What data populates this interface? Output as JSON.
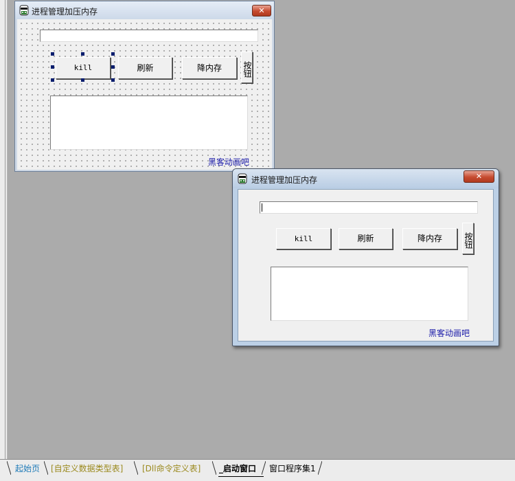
{
  "design_form": {
    "title": "进程管理加压内存",
    "close_glyph": "✕",
    "buttons": {
      "kill": "kill",
      "refresh": "刷新",
      "reduce_memory": "降内存",
      "button": "按钮"
    },
    "link_label": "黑客动画吧"
  },
  "runtime_window": {
    "title": "进程管理加压内存",
    "close_glyph": "✕",
    "buttons": {
      "kill": "kill",
      "refresh": "刷新",
      "reduce_memory": "降内存",
      "button": "按钮"
    },
    "link_label": "黑客动画吧"
  },
  "tabs": [
    {
      "label": "起始页",
      "color": "#1f7bb8"
    },
    {
      "label": "[自定义数据类型表]",
      "color": "#9b8a1e"
    },
    {
      "label": "[Dll命令定义表]",
      "color": "#9b8a1e"
    },
    {
      "label": "_启动窗口",
      "color": "#000000",
      "active": true
    },
    {
      "label": "窗口程序集1",
      "color": "#000000"
    }
  ]
}
